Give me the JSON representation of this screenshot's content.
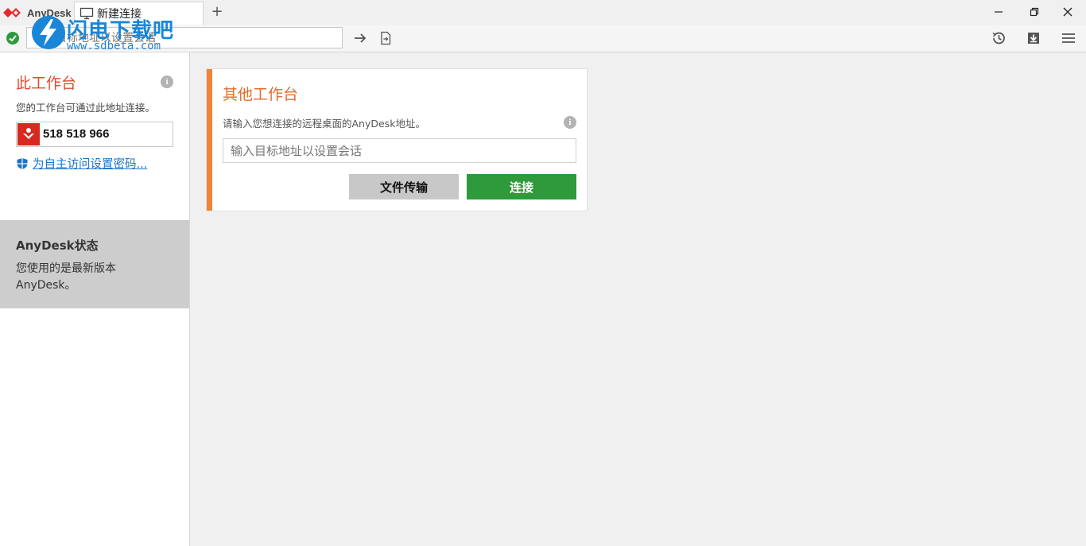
{
  "app": {
    "brand": "AnyDesk"
  },
  "tabs": [
    {
      "label": "新建连接"
    }
  ],
  "tab_add": "+",
  "address_bar": {
    "placeholder": "输入目标地址以设置会话"
  },
  "watermark": {
    "title": "闪电下载吧",
    "url": "www.sdbeta.com"
  },
  "sidebar": {
    "title": "此工作台",
    "description": "您的工作台可通过此地址连接。",
    "id": "518 518 966",
    "password_link": "为自主访问设置密码..."
  },
  "status_panel": {
    "title": "AnyDesk状态",
    "text": "您使用的是最新版本 AnyDesk。"
  },
  "remote_card": {
    "title": "其他工作台",
    "description": "请输入您想连接的远程桌面的AnyDesk地址。",
    "placeholder": "输入目标地址以设置会话",
    "file_transfer_label": "文件传输",
    "connect_label": "连接"
  },
  "colors": {
    "brand_red": "#e44b2f",
    "accent_orange": "#f0843a",
    "connect_green": "#2e9a3b",
    "link_blue": "#1a73c8"
  },
  "icons": [
    "anydesk-logo-icon",
    "monitor-icon",
    "check-icon",
    "arrow-right-icon",
    "file-transfer-icon",
    "history-icon",
    "download-icon",
    "menu-icon",
    "info-icon",
    "shield-icon",
    "minimize-icon",
    "restore-icon",
    "close-icon"
  ]
}
